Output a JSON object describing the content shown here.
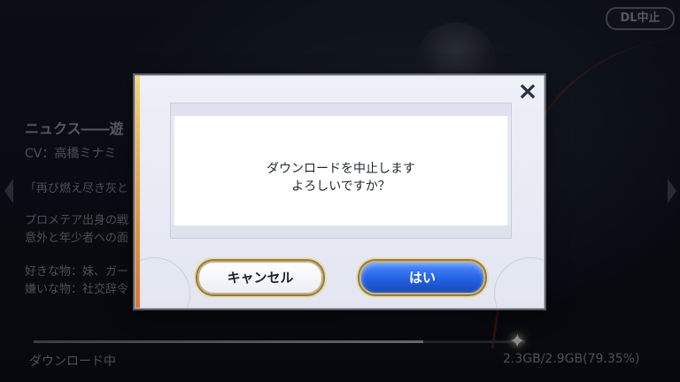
{
  "top_button": {
    "label": "DL中止"
  },
  "background_profile": {
    "name": "ニュクス――遊",
    "cv": "CV：高橋ミナミ",
    "quote": "「再び燃え尽き灰と",
    "desc_line1": "プロメテア出身の戦",
    "desc_line2": "意外と年少者への面",
    "like": "好きな物：妹、ガー",
    "dislike": "嫌いな物：社交辞令"
  },
  "download_status": {
    "label": "ダウンロード中",
    "size_text": "2.3GB/2.9GB(79.35%)",
    "progress": 0.7935
  },
  "dialog": {
    "message_line1": "ダウンロードを中止します",
    "message_line2": "よろしいですか？",
    "cancel_label": "キャンセル",
    "yes_label": "はい",
    "close_icon": "×"
  },
  "colors": {
    "accent_blue": "#2261e3",
    "gold_border": "#c9b178"
  }
}
